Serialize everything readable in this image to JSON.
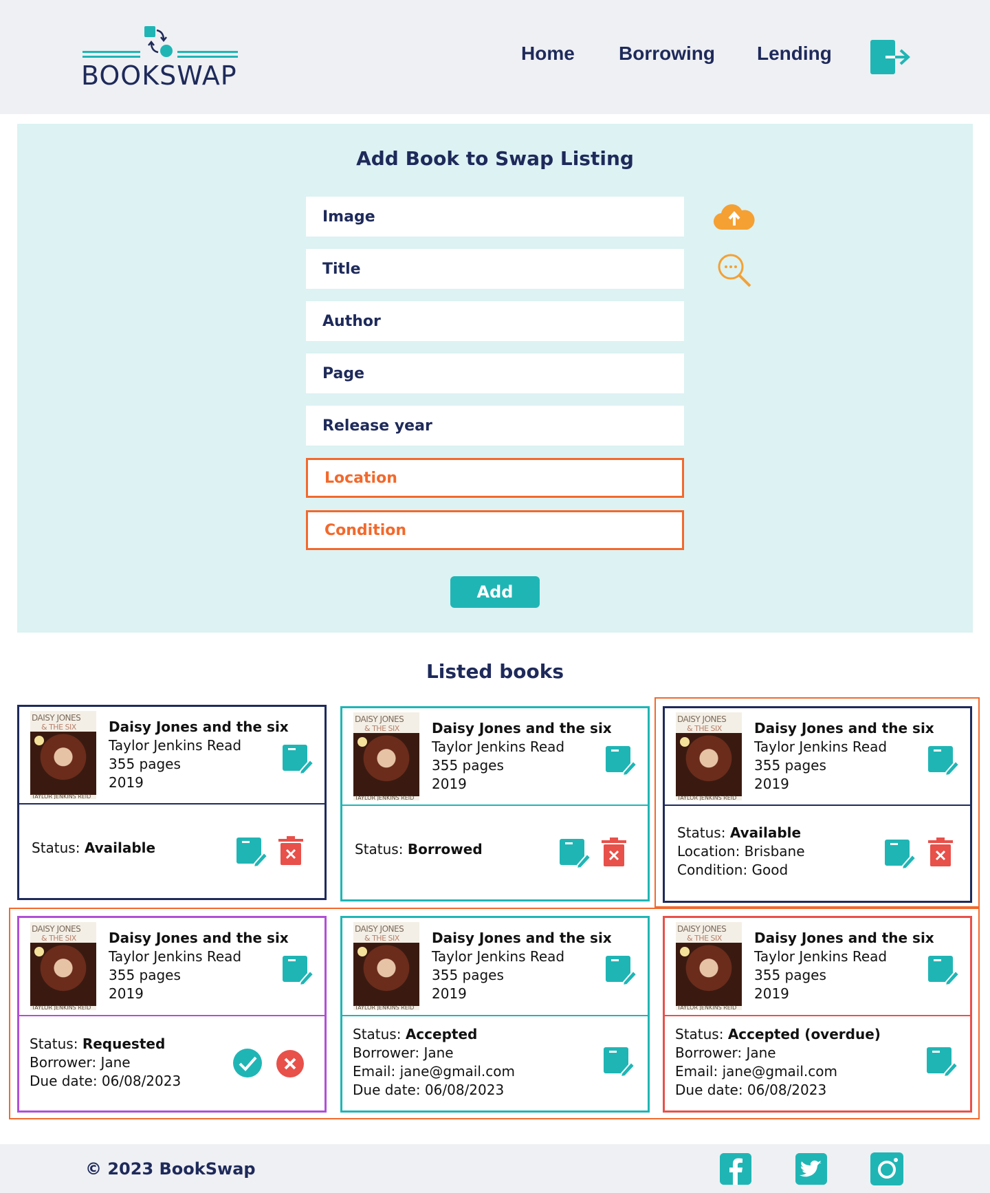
{
  "brand": {
    "name": "BOOKSWAP",
    "accent": "#20b5b5",
    "navy": "#1e2a5a",
    "warning": "#f2692c"
  },
  "nav": {
    "home": "Home",
    "borrowing": "Borrowing",
    "lending": "Lending",
    "logout_icon": "logout-icon"
  },
  "form": {
    "title": "Add Book to Swap Listing",
    "fields": {
      "image": "Image",
      "title": "Title",
      "author": "Author",
      "page": "Page",
      "release_year": "Release year",
      "location": "Location",
      "condition": "Condition"
    },
    "upload_icon": "cloud-upload-icon",
    "search_icon": "search-icon",
    "add_label": "Add"
  },
  "listed": {
    "title": "Listed books",
    "cover": {
      "title_line1": "DAISY JONES",
      "title_line2": "& THE SIX",
      "author": "TAYLOR JENKINS REID"
    },
    "cards": [
      {
        "book_title": "Daisy Jones and the six",
        "author": "Taylor Jenkins Read",
        "pages": "355 pages",
        "year": "2019",
        "status_label": "Status:",
        "status_value": "Available",
        "border": "#1e2a5a"
      },
      {
        "book_title": "Daisy Jones and the six",
        "author": "Taylor Jenkins Read",
        "pages": "355 pages",
        "year": "2019",
        "status_label": "Status:",
        "status_value": "Borrowed",
        "border": "#20b5b5"
      },
      {
        "book_title": "Daisy Jones and the six",
        "author": "Taylor Jenkins Read",
        "pages": "355 pages",
        "year": "2019",
        "status_label": "Status:",
        "status_value": "Available",
        "location": "Location: Brisbane",
        "condition": "Condition: Good",
        "border": "#1e2a5a"
      },
      {
        "book_title": "Daisy Jones and the six",
        "author": "Taylor Jenkins Read",
        "pages": "355 pages",
        "year": "2019",
        "status_label": "Status:",
        "status_value": "Requested",
        "borrower": "Borrower: Jane",
        "due": "Due date: 06/08/2023",
        "border": "#b04fd6"
      },
      {
        "book_title": "Daisy Jones and the six",
        "author": "Taylor Jenkins Read",
        "pages": "355 pages",
        "year": "2019",
        "status_label": "Status:",
        "status_value": "Accepted",
        "borrower": "Borrower: Jane",
        "email": "Email: jane@gmail.com",
        "due": "Due date: 06/08/2023",
        "border": "#20b5b5"
      },
      {
        "book_title": "Daisy Jones and the six",
        "author": "Taylor Jenkins Read",
        "pages": "355 pages",
        "year": "2019",
        "status_label": "Status:",
        "status_value": "Accepted (overdue)",
        "borrower": "Borrower: Jane",
        "email": "Email: jane@gmail.com",
        "due": "Due date: 06/08/2023",
        "border": "#e8504a"
      }
    ]
  },
  "footer": {
    "copyright": "© 2023 BookSwap",
    "social": [
      "facebook-icon",
      "twitter-icon",
      "instagram-icon"
    ]
  }
}
